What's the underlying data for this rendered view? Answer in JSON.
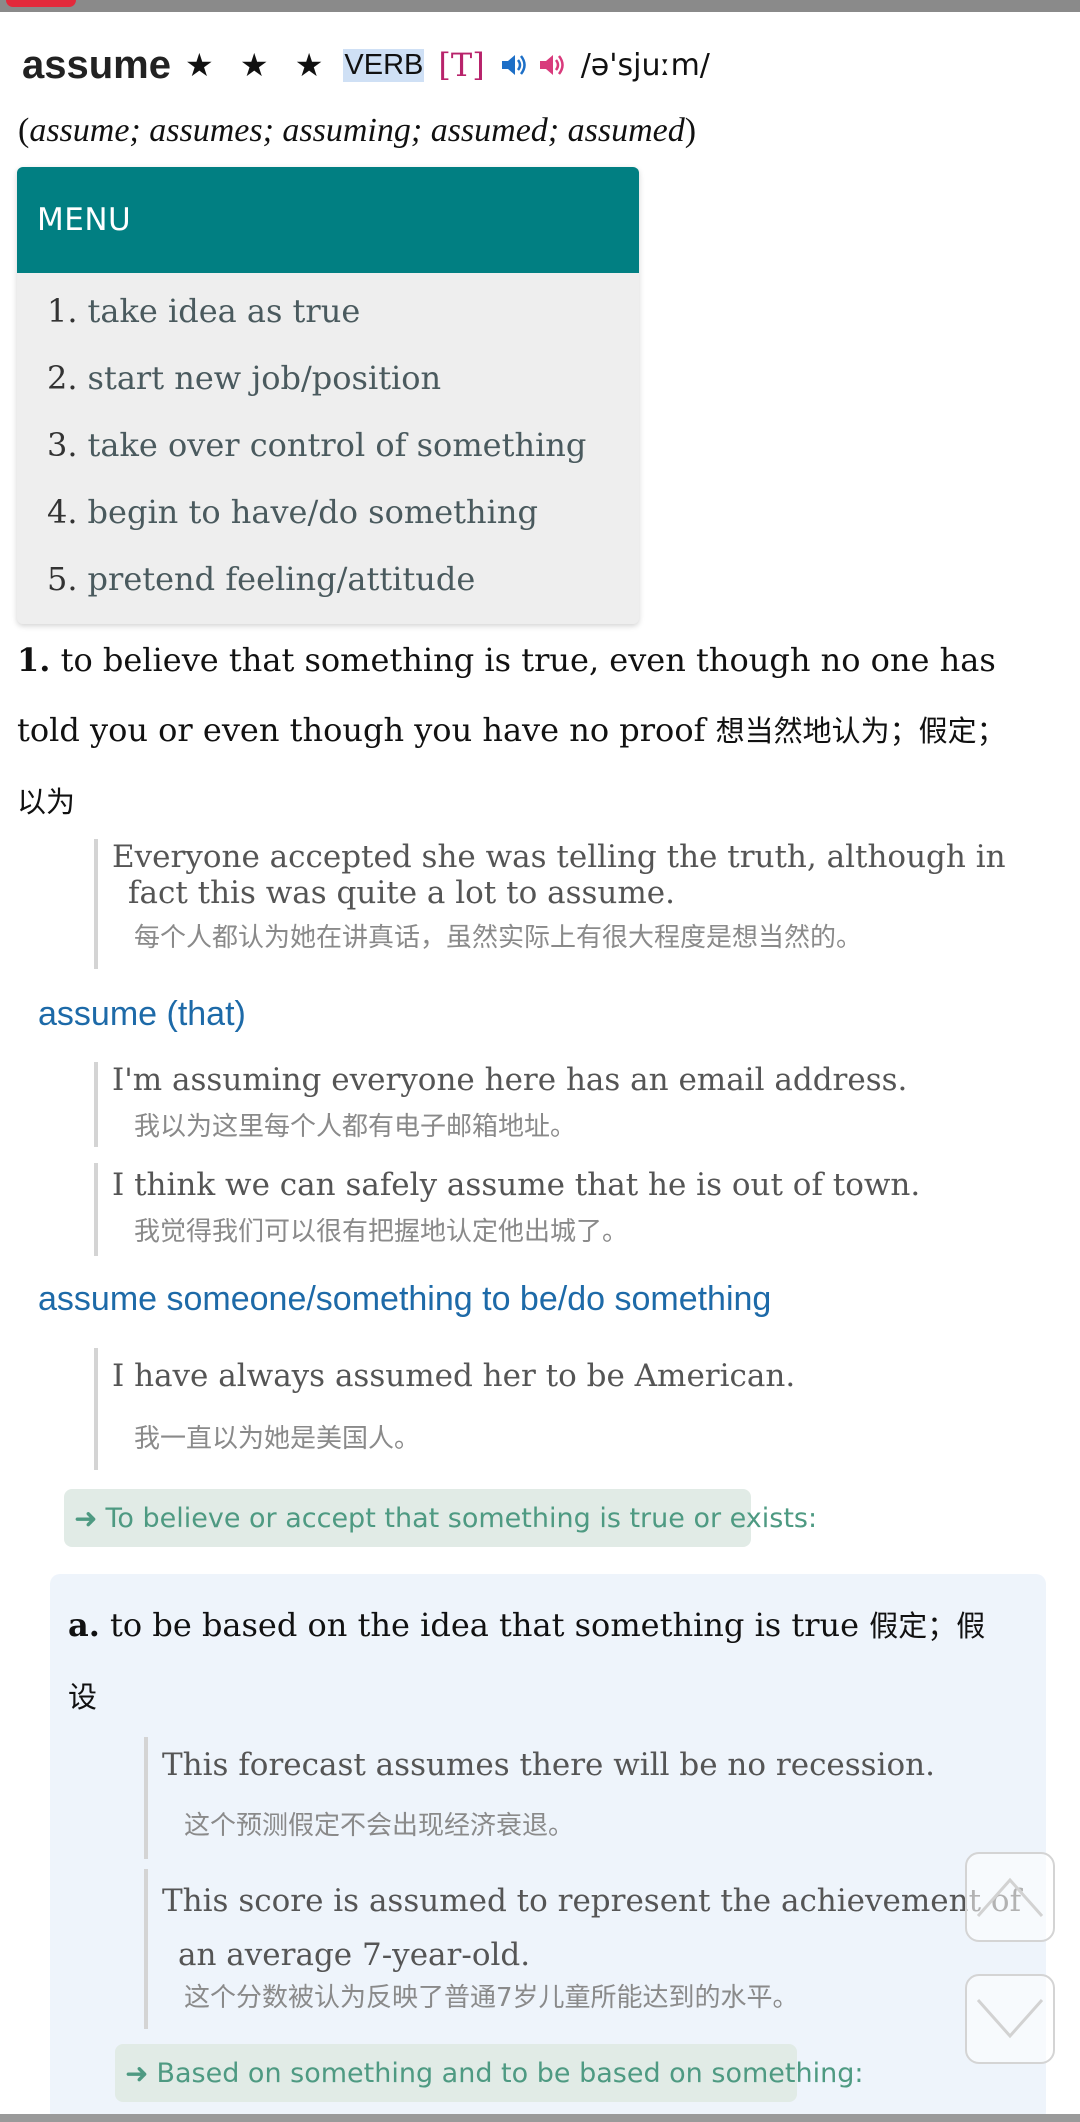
{
  "entry": {
    "headword": "assume",
    "stars": "★ ★ ★",
    "part_of_speech": "VERB",
    "grammar": "[T]",
    "pronunciation": "/ə'sjuːm/",
    "uk_audio_icon": "speaker-blue-icon",
    "us_audio_icon": "speaker-pink-icon"
  },
  "inflections": {
    "open": "(",
    "forms": "assume; assumes; assuming; assumed; assumed",
    "close": ")"
  },
  "menu": {
    "title": "MENU",
    "items": [
      {
        "num": "1.",
        "label": "take idea as true"
      },
      {
        "num": "2.",
        "label": "start new job/position"
      },
      {
        "num": "3.",
        "label": "take over control of something"
      },
      {
        "num": "4.",
        "label": "begin to have/do something"
      },
      {
        "num": "5.",
        "label": "pretend feeling/attitude"
      }
    ]
  },
  "sense1": {
    "num": "1.",
    "line1": "to believe that something is true, even though no one has",
    "line2_en": "told you or even though you have no proof",
    "line2_cn": "想当然地认为；假定；",
    "line3_cn": "以为",
    "example": {
      "en_line1": "Everyone accepted she was telling the truth, although in",
      "en_line2": "fact this was quite a lot to assume.",
      "cn": "每个人都认为她在讲真话，虽然实际上有很大程度是想当然的。"
    },
    "pattern1": {
      "label": "assume (that)",
      "examples": [
        {
          "en": "I'm assuming everyone here has an email address.",
          "cn": "我以为这里每个人都有电子邮箱地址。"
        },
        {
          "en": "I think we can safely assume that he is out of town.",
          "cn": "我觉得我们可以很有把握地认定他出城了。"
        }
      ]
    },
    "pattern2": {
      "label": "assume someone/something to be/do something",
      "example": {
        "en": "I have always assumed her to be American.",
        "cn": "我一直以为她是美国人。"
      }
    },
    "hint": {
      "arrow": "➜",
      "text": "To believe or accept that something is true or exists:"
    }
  },
  "sense1a": {
    "letter": "a.",
    "line1_en": "to be based on the idea that something is true",
    "line1_cn": "假定；假",
    "line2_cn": "设",
    "examples": [
      {
        "en": "This forecast assumes there will be no recession.",
        "cn": "这个预测假定不会出现经济衰退。"
      },
      {
        "en_line1": "This score is assumed to represent the achievement of",
        "en_line2": "an average 7-year-old.",
        "cn": "这个分数被认为反映了普通7岁儿童所能达到的水平。"
      }
    ],
    "hint": {
      "arrow": "➜",
      "text": "Based on something and to be based on something:"
    }
  },
  "nav": {
    "up_icon": "chevron-up-icon",
    "down_icon": "chevron-down-icon"
  }
}
